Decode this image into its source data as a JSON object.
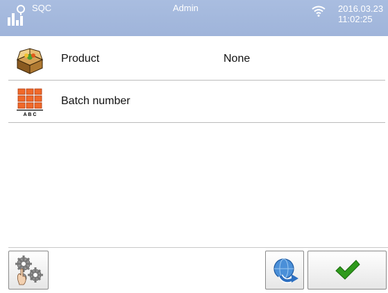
{
  "header": {
    "app_name": "SQC",
    "user": "Admin",
    "date": "2016.03.23",
    "time": "11:02:25",
    "logo_icon": "sqc-chart-icon",
    "wifi_icon": "wifi-icon"
  },
  "rows": [
    {
      "icon": "product-box-icon",
      "label": "Product",
      "value": "None"
    },
    {
      "icon": "batch-number-icon",
      "label": "Batch number",
      "value": "",
      "icon_caption": "A B C"
    }
  ],
  "footer": {
    "settings_icon": "gears-settings-icon",
    "refresh_icon": "globe-refresh-icon",
    "confirm_icon": "checkmark-icon"
  },
  "colors": {
    "header_bg": "#a9bde0",
    "confirm_green": "#2f9a1c",
    "batch_orange": "#f0692a"
  }
}
